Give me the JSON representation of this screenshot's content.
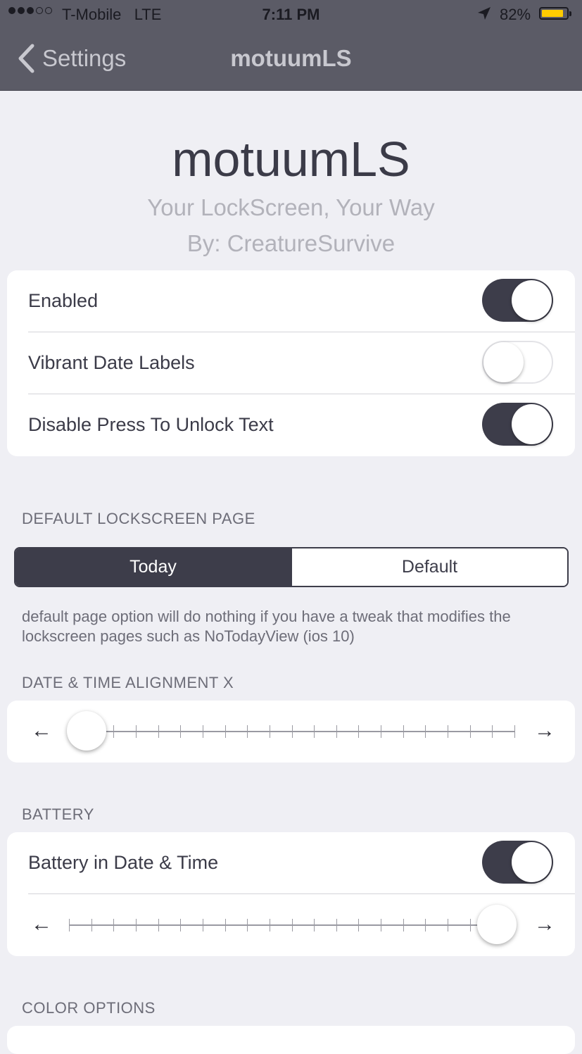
{
  "status_bar": {
    "carrier": "T-Mobile",
    "network": "LTE",
    "time": "7:11 PM",
    "battery_percent": "82%",
    "battery_level": 0.82,
    "signal_bars_filled": 3,
    "signal_bars_total": 5,
    "battery_color": "#ffcc00"
  },
  "nav": {
    "back_label": "Settings",
    "title": "motuumLS"
  },
  "header": {
    "title": "motuumLS",
    "subtitle": "Your LockScreen, Your Way",
    "author": "By: CreatureSurvive"
  },
  "toggles": [
    {
      "label": "Enabled",
      "on": true
    },
    {
      "label": "Vibrant Date Labels",
      "on": false
    },
    {
      "label": "Disable Press To Unlock Text",
      "on": true
    }
  ],
  "default_page": {
    "header": "DEFAULT LOCKSCREEN PAGE",
    "options": [
      "Today",
      "Default"
    ],
    "selected": "Today",
    "footnote": "default page option will do nothing if you have a tweak that modifies the lockscreen pages such as NoTodayView (ios 10)"
  },
  "alignment": {
    "header": "DATE & TIME ALIGNMENT X",
    "left_arrow": "←",
    "right_arrow": "→",
    "value_fraction": 0.04,
    "tick_count": 21
  },
  "battery": {
    "header": "BATTERY",
    "toggle_label": "Battery in Date & Time",
    "toggle_on": true,
    "left_arrow": "←",
    "right_arrow": "→",
    "slider_value_fraction": 0.96,
    "tick_count": 21
  },
  "color_options": {
    "header": "COLOR OPTIONS"
  },
  "colors": {
    "accent": "#3d3d4a",
    "nav_background": "#5b5b66",
    "page_background": "#efeff4"
  }
}
